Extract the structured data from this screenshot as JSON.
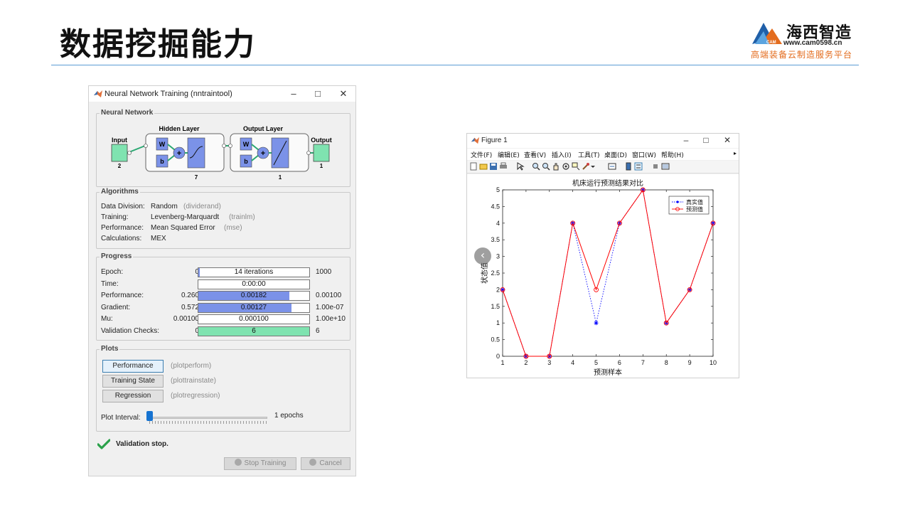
{
  "slide": {
    "title": "数据挖掘能力",
    "logo": {
      "name": "海西智造",
      "mark_text": "CAM",
      "url": "www.cam0598.cn",
      "tagline": "高端装备云制造服务平台"
    }
  },
  "nntraintool": {
    "window_title": "Neural Network Training (nntraintool)",
    "network": {
      "section": "Neural Network",
      "input_label": "Input",
      "input_size": "2",
      "hidden_label": "Hidden Layer",
      "hidden_size": "7",
      "output_layer_label": "Output Layer",
      "output_layer_size": "1",
      "output_label": "Output",
      "output_size": "1",
      "w": "W",
      "b": "b",
      "plus": "+"
    },
    "algorithms": {
      "section": "Algorithms",
      "rows": [
        {
          "label": "Data Division:",
          "value": "Random",
          "note": "(dividerand)"
        },
        {
          "label": "Training:",
          "value": "Levenberg-Marquardt",
          "note": "(trainlm)"
        },
        {
          "label": "Performance:",
          "value": "Mean Squared Error",
          "note": "(mse)"
        },
        {
          "label": "Calculations:",
          "value": "MEX",
          "note": ""
        }
      ]
    },
    "progress": {
      "section": "Progress",
      "rows": [
        {
          "label": "Epoch:",
          "start": "0",
          "current": "14 iterations",
          "end": "1000",
          "fill": 0.014,
          "color": "#7b92e8"
        },
        {
          "label": "Time:",
          "start": "",
          "current": "0:00:00",
          "end": "",
          "fill": 0,
          "color": "#7b92e8"
        },
        {
          "label": "Performance:",
          "start": "0.260",
          "current": "0.00182",
          "end": "0.00100",
          "fill": 0.82,
          "color": "#7b92e8"
        },
        {
          "label": "Gradient:",
          "start": "0.572",
          "current": "0.00127",
          "end": "1.00e-07",
          "fill": 0.84,
          "color": "#7b92e8"
        },
        {
          "label": "Mu:",
          "start": "0.00100",
          "current": "0.000100",
          "end": "1.00e+10",
          "fill": 0,
          "color": "#7b92e8"
        },
        {
          "label": "Validation Checks:",
          "start": "0",
          "current": "6",
          "end": "6",
          "fill": 1.0,
          "color": "#7fe3b0"
        }
      ]
    },
    "plots": {
      "section": "Plots",
      "buttons": [
        {
          "label": "Performance",
          "note": "(plotperform)"
        },
        {
          "label": "Training State",
          "note": "(plottrainstate)"
        },
        {
          "label": "Regression",
          "note": "(plotregression)"
        }
      ],
      "interval_label": "Plot Interval:",
      "interval_value": "1 epochs"
    },
    "status": "Validation stop.",
    "stop_button": "Stop Training",
    "cancel_button": "Cancel"
  },
  "figure": {
    "window_title": "Figure 1",
    "menus": [
      "文件(F)",
      "编辑(E)",
      "查看(V)",
      "插入(I)",
      "工具(T)",
      "桌面(D)",
      "窗口(W)",
      "帮助(H)"
    ]
  },
  "chart_data": {
    "type": "line",
    "title": "机床运行预测结果对比",
    "xlabel": "预测样本",
    "ylabel": "状态值",
    "x": [
      1,
      2,
      3,
      4,
      5,
      6,
      7,
      8,
      9,
      10
    ],
    "xlim": [
      1,
      10
    ],
    "ylim": [
      0,
      5
    ],
    "xticks": [
      "1",
      "2",
      "3",
      "4",
      "5",
      "6",
      "7",
      "8",
      "9",
      "10"
    ],
    "yticks": [
      "0",
      "0.5",
      "1",
      "1.5",
      "2",
      "2.5",
      "3",
      "3.5",
      "4",
      "4.5",
      "5"
    ],
    "grid": false,
    "legend_position": "top-right",
    "series": [
      {
        "name": "真实值",
        "values": [
          2,
          0,
          0,
          4,
          1,
          4,
          5,
          1,
          2,
          4
        ],
        "color": "#0000ff",
        "marker": "*",
        "line": "dotted"
      },
      {
        "name": "预测值",
        "values": [
          2,
          0,
          0,
          4,
          2,
          4,
          5,
          1,
          2,
          4
        ],
        "color": "#ff0000",
        "marker": "o",
        "line": "solid"
      }
    ]
  },
  "nav": {
    "prev_glyph": "‹"
  }
}
